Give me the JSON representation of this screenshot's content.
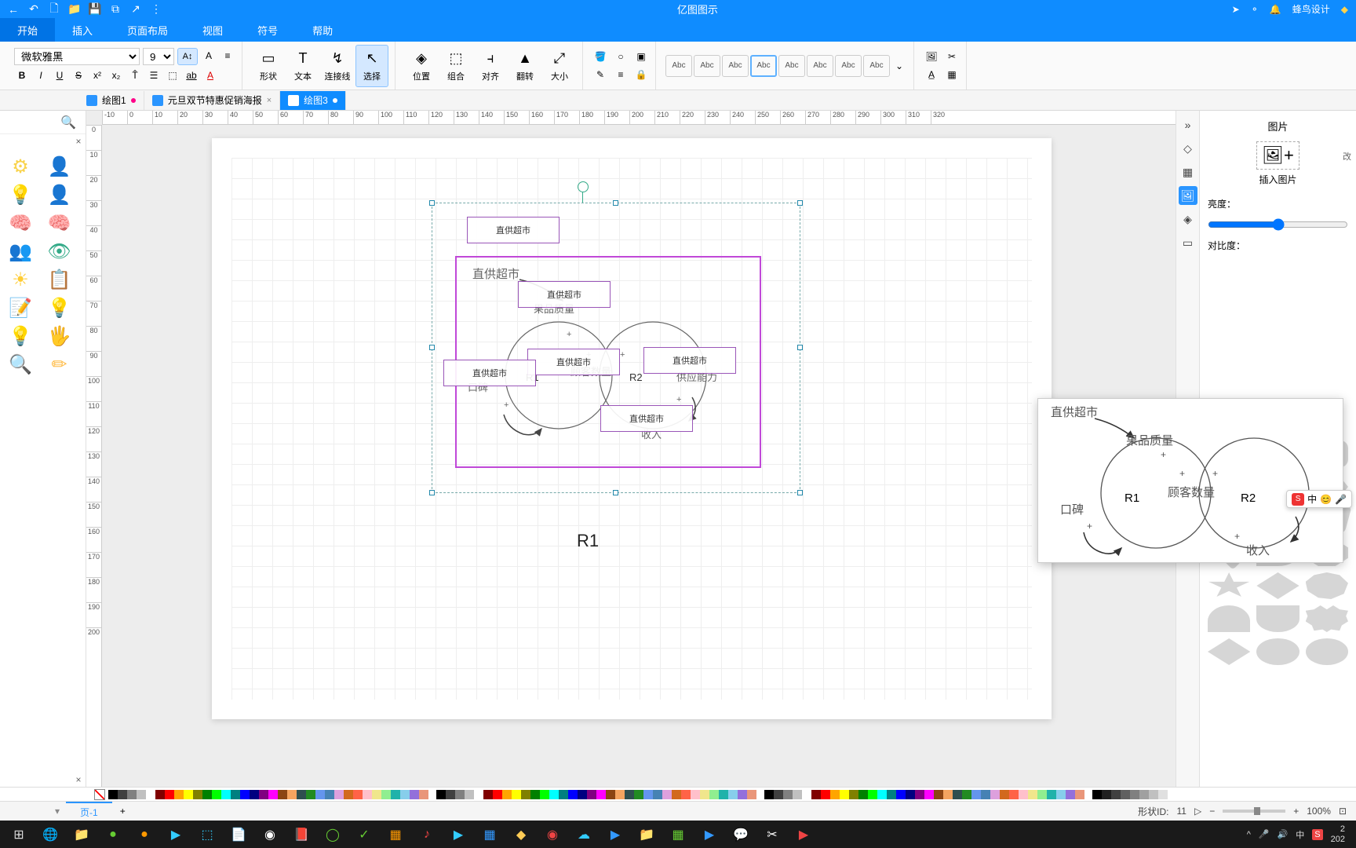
{
  "app": {
    "title": "亿图图示"
  },
  "quick": [
    "←",
    "⤴",
    "🗋",
    "📁",
    "💾",
    "🗔",
    "🗐",
    "↗",
    "⋮"
  ],
  "titleTray": {
    "send": "➤",
    "share": "⚬",
    "bell": "🔔",
    "user": "蜂鸟设计",
    "gem": "◆"
  },
  "menu": {
    "items": [
      "开始",
      "插入",
      "页面布局",
      "视图",
      "符号",
      "帮助"
    ],
    "active": 0
  },
  "ribbon": {
    "font": "微软雅黑",
    "size": "9",
    "styleBtns": [
      {
        "ic": "A↕",
        "active": true
      },
      {
        "ic": "A"
      },
      {
        "ic": "≡▾"
      }
    ],
    "textRow2": [
      "B",
      "I",
      "U",
      "S",
      "x²",
      "x₂",
      "T̂",
      "☰▾",
      "⬚▾",
      "ab",
      "A"
    ],
    "tools": [
      {
        "ic": "▭",
        "lbl": "形状"
      },
      {
        "ic": "T",
        "lbl": "文本"
      },
      {
        "ic": "⤷",
        "lbl": "连接线"
      },
      {
        "ic": "↖",
        "lbl": "选择",
        "active": true
      }
    ],
    "arrange": [
      {
        "ic": "⬚",
        "lbl": "位置"
      },
      {
        "ic": "⬚⬚",
        "lbl": "组合"
      },
      {
        "ic": "⫞",
        "lbl": "对齐"
      },
      {
        "ic": "▲",
        "lbl": "翻转"
      },
      {
        "ic": "⤢",
        "lbl": "大小"
      }
    ],
    "style": [
      "Abc",
      "Abc",
      "Abc",
      "Abc",
      "Abc",
      "Abc",
      "Abc",
      "Abc"
    ],
    "styleSel": 3
  },
  "docs": [
    {
      "name": "绘图1",
      "dirty": true,
      "active": false
    },
    {
      "name": "元旦双节特惠促销海报",
      "dirty": false,
      "active": false,
      "closable": true
    },
    {
      "name": "绘图3",
      "dirty": true,
      "active": true
    }
  ],
  "rulerH": [
    "-10",
    "0",
    "10",
    "20",
    "30",
    "40",
    "50",
    "60",
    "70",
    "80",
    "90",
    "100",
    "110",
    "120",
    "130",
    "140",
    "150",
    "160",
    "170",
    "180",
    "190",
    "200",
    "210",
    "220",
    "230",
    "240",
    "250",
    "260",
    "270",
    "280",
    "290",
    "300",
    "310",
    "320"
  ],
  "rulerV": [
    "0",
    "10",
    "20",
    "30",
    "40",
    "50",
    "60",
    "70",
    "80",
    "90",
    "100",
    "110",
    "120",
    "130",
    "140",
    "150",
    "160",
    "170",
    "180",
    "190",
    "200"
  ],
  "leftShapes": [
    "🧠",
    "👤",
    "💡",
    "🧑",
    "🧬",
    "👁",
    "👥",
    "👁",
    "☀",
    "📋",
    "📝",
    "💡",
    "💡",
    "🖐",
    "🔍",
    "✏"
  ],
  "canvas": {
    "label_top": "直供超市",
    "label_group": "直供超市",
    "quality": "果品质量",
    "overQuality": "直供超市",
    "customers": "顾客数量",
    "overCust": "直供超市",
    "koubei": "口碑",
    "overKoubei": "直供超市",
    "supply": "供应能力",
    "overSupply": "直供超市",
    "income": "收入",
    "overIncome": "直供超市",
    "r1": "R1",
    "r2": "R2",
    "bigR1": "R1",
    "plus": "+"
  },
  "preview": {
    "top": "直供超市",
    "quality": "果品质量",
    "customers": "顾客数量",
    "koubei": "口碑",
    "supply": "供应能力",
    "income": "收入",
    "r1": "R1",
    "r2": "R2",
    "plus": "+",
    "ime": "中"
  },
  "prop": {
    "title": "图片",
    "insert": "插入图片",
    "brightness": "亮度：",
    "contrast": "对比度：",
    "more": "改"
  },
  "page": {
    "tab": "页-1"
  },
  "status": {
    "shape": "形状ID:",
    "id": "11",
    "zoom": "100%",
    "fit": "⊡"
  },
  "colors": [
    "#000",
    "#404040",
    "#808080",
    "#c0c0c0",
    "#fff",
    "#800000",
    "#ff0000",
    "#ffa500",
    "#ffff00",
    "#808000",
    "#008000",
    "#00ff00",
    "#00ffff",
    "#008080",
    "#0000ff",
    "#000080",
    "#800080",
    "#ff00ff",
    "#8b4513",
    "#f4a460",
    "#2f4f4f",
    "#228b22",
    "#6495ed",
    "#4682b4",
    "#dda0dd",
    "#d2691e",
    "#ff6347",
    "#ffc0cb",
    "#f0e68c",
    "#90ee90",
    "#20b2aa",
    "#87ceeb",
    "#9370db",
    "#e9967a"
  ]
}
